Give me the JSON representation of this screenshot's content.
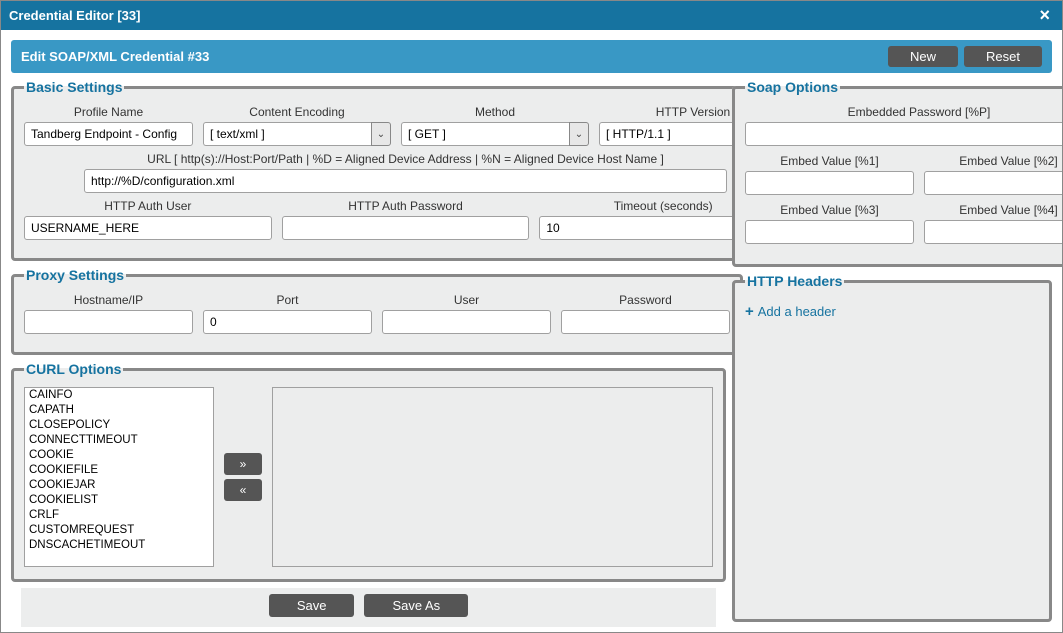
{
  "window": {
    "title": "Credential Editor [33]"
  },
  "header": {
    "title": "Edit SOAP/XML Credential #33",
    "new_btn": "New",
    "reset_btn": "Reset"
  },
  "basic": {
    "legend": "Basic Settings",
    "profile_name": {
      "label": "Profile Name",
      "value": "Tandberg Endpoint - Config"
    },
    "content_encoding": {
      "label": "Content Encoding",
      "value": "[ text/xml ]"
    },
    "method": {
      "label": "Method",
      "value": "[ GET ]"
    },
    "http_version": {
      "label": "HTTP Version",
      "value": "[ HTTP/1.1 ]"
    },
    "url": {
      "label": "URL [ http(s)://Host:Port/Path | %D = Aligned Device Address | %N = Aligned Device Host Name ]",
      "value": "http://%D/configuration.xml"
    },
    "auth_user": {
      "label": "HTTP Auth User",
      "value": "USERNAME_HERE"
    },
    "auth_pass": {
      "label": "HTTP Auth Password",
      "value": ""
    },
    "timeout": {
      "label": "Timeout (seconds)",
      "value": "10"
    }
  },
  "soap": {
    "legend": "Soap Options",
    "embedded_password": {
      "label": "Embedded Password [%P]",
      "value": ""
    },
    "embed1": {
      "label": "Embed Value [%1]",
      "value": ""
    },
    "embed2": {
      "label": "Embed Value [%2]",
      "value": ""
    },
    "embed3": {
      "label": "Embed Value [%3]",
      "value": ""
    },
    "embed4": {
      "label": "Embed Value [%4]",
      "value": ""
    }
  },
  "proxy": {
    "legend": "Proxy Settings",
    "hostname": {
      "label": "Hostname/IP",
      "value": ""
    },
    "port": {
      "label": "Port",
      "value": "0"
    },
    "user": {
      "label": "User",
      "value": ""
    },
    "password": {
      "label": "Password",
      "value": ""
    }
  },
  "headers": {
    "legend": "HTTP Headers",
    "add_label": "Add a header"
  },
  "curl": {
    "legend": "CURL Options",
    "options": [
      "CAINFO",
      "CAPATH",
      "CLOSEPOLICY",
      "CONNECTTIMEOUT",
      "COOKIE",
      "COOKIEFILE",
      "COOKIEJAR",
      "COOKIELIST",
      "CRLF",
      "CUSTOMREQUEST",
      "DNSCACHETIMEOUT"
    ],
    "add_btn": "»",
    "remove_btn": "«"
  },
  "footer": {
    "save": "Save",
    "save_as": "Save As"
  }
}
